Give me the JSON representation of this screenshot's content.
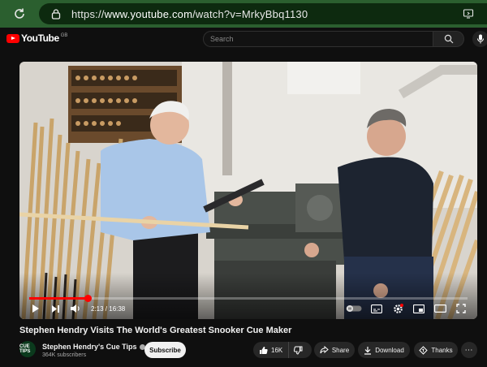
{
  "browser": {
    "url_prefix": "https://",
    "url_main": "www.youtube.com",
    "url_rest": "/watch?v=MrkyBbq1130"
  },
  "header": {
    "logo_text": "YouTube",
    "logo_country": "GB",
    "search_placeholder": "Search"
  },
  "player": {
    "current_time": "2:13",
    "duration": "16:38",
    "time_display": "2:13 / 16:38",
    "progress_fraction": 0.133
  },
  "video": {
    "title": "Stephen Hendry Visits The World's Greatest Snooker Cue Maker"
  },
  "channel": {
    "name": "Stephen Hendry's Cue Tips",
    "subscribers": "364K subscribers",
    "avatar_text": "CUE TIPS",
    "subscribe_label": "Subscribe"
  },
  "actions": {
    "likes": "16K",
    "share_label": "Share",
    "download_label": "Download",
    "thanks_label": "Thanks"
  },
  "icons": [
    "reload-icon",
    "lock-icon",
    "screen-share-icon",
    "search-icon",
    "mic-icon",
    "play-icon",
    "next-icon",
    "volume-icon",
    "autoplay-toggle-icon",
    "subtitles-icon",
    "settings-icon",
    "miniplayer-icon",
    "theater-icon",
    "fullscreen-icon",
    "verified-icon",
    "like-icon",
    "dislike-icon",
    "share-icon",
    "download-icon",
    "thanks-icon",
    "more-icon"
  ],
  "colors": {
    "accent": "#ff0000",
    "browser_bar": "#2b5f2f",
    "background": "#0f0f0f"
  }
}
